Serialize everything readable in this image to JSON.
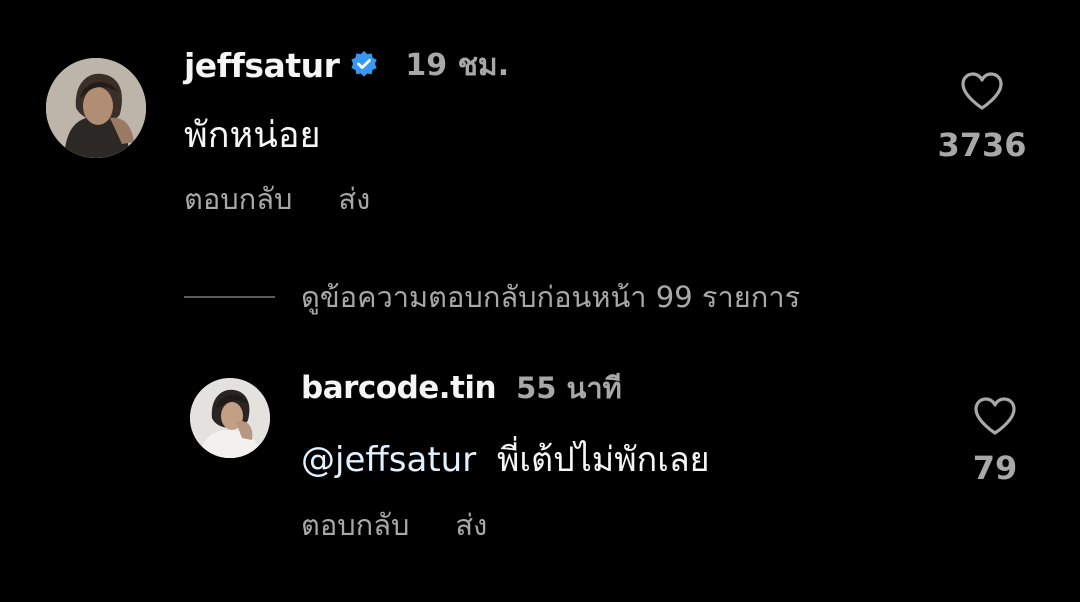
{
  "colors": {
    "background": "#000000",
    "primary_text": "#f5f5f5",
    "secondary_text": "#a8a8a8",
    "verified_badge": "#3897f0",
    "divider": "#5c5c5c"
  },
  "comments": [
    {
      "username": "jeffsatur",
      "verified": true,
      "time": "19 ชม.",
      "text": "พักหน่อย",
      "like_icon": "heart-outline-icon",
      "likes": "3736",
      "reply_label": "ตอบกลับ",
      "send_label": "ส่ง"
    }
  ],
  "view_replies": {
    "label": "ดูข้อความตอบกลับก่อนหน้า 99 รายการ"
  },
  "replies": [
    {
      "username": "barcode.tin",
      "verified": false,
      "time": "55 นาที",
      "mention": "@jeffsatur",
      "text": "พี่เต้ปไม่พักเลย",
      "like_icon": "heart-outline-icon",
      "likes": "79",
      "reply_label": "ตอบกลับ",
      "send_label": "ส่ง"
    }
  ]
}
